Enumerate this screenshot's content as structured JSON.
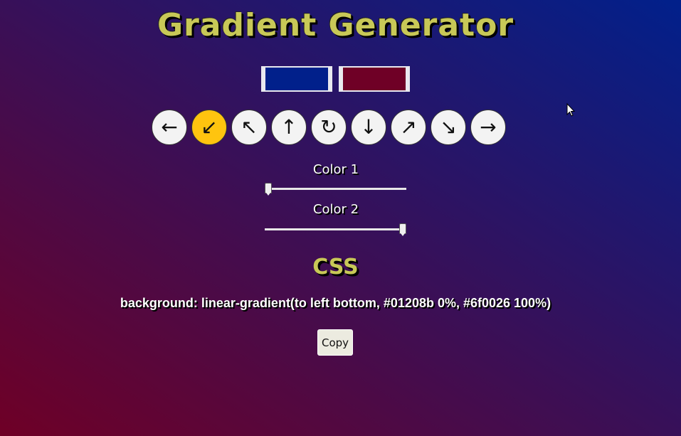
{
  "app": {
    "title": "Gradient Generator"
  },
  "colors": {
    "color1": "#01208b",
    "color2": "#6f0026",
    "accent_title": "#c8c857",
    "active_direction": "#ffc40f"
  },
  "directions": [
    {
      "icon": "arrow-left-icon",
      "glyph": "←",
      "active": false
    },
    {
      "icon": "arrow-down-left-icon",
      "glyph": "↙",
      "active": true
    },
    {
      "icon": "arrow-up-left-icon",
      "glyph": "↖",
      "active": false
    },
    {
      "icon": "arrow-up-icon",
      "glyph": "↑",
      "active": false
    },
    {
      "icon": "radial-icon",
      "glyph": "↻",
      "active": false
    },
    {
      "icon": "arrow-down-icon",
      "glyph": "↓",
      "active": false
    },
    {
      "icon": "arrow-up-right-icon",
      "glyph": "↗",
      "active": false
    },
    {
      "icon": "arrow-down-right-icon",
      "glyph": "↘",
      "active": false
    },
    {
      "icon": "arrow-right-icon",
      "glyph": "→",
      "active": false
    }
  ],
  "sliders": {
    "color1": {
      "label": "Color 1",
      "value_percent": 0
    },
    "color2": {
      "label": "Color 2",
      "value_percent": 100
    }
  },
  "css": {
    "heading": "CSS",
    "output": "background: linear-gradient(to left bottom, #01208b 0%, #6f0026 100%)"
  },
  "copy_button": {
    "label": "Copy"
  }
}
